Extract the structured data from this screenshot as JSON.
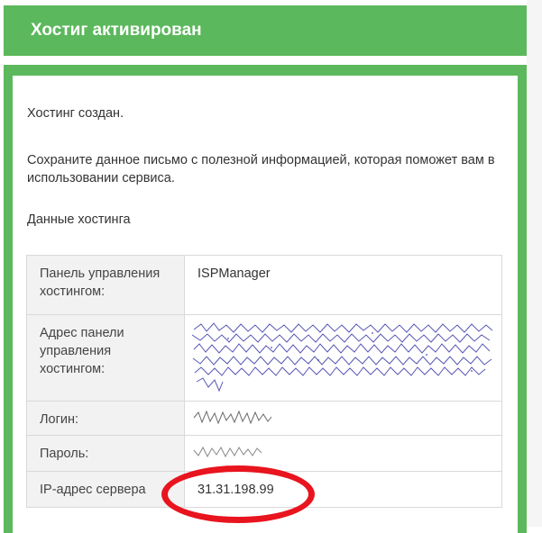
{
  "header": {
    "title": "Хостиг активирован"
  },
  "message": {
    "line1": "Хостинг создан.",
    "line2": "Сохраните данное письмо с полезной информацией, которая поможет вам в использовании сервиса.",
    "line3": "Данные хостинга"
  },
  "table": {
    "rows": [
      {
        "label": "Панель управления хостингом:",
        "value": "ISPManager"
      },
      {
        "label": "Адрес панели управления хостингом:",
        "value": ""
      },
      {
        "label": "Логин:",
        "value": ""
      },
      {
        "label": "Пароль:",
        "value": ""
      },
      {
        "label": "IP-адрес сервера",
        "value": "31.31.198.99"
      }
    ]
  },
  "colors": {
    "brand_green": "#5cb85c",
    "highlight_red": "#e8141e",
    "redacted_ink": "#3a3aa8"
  }
}
